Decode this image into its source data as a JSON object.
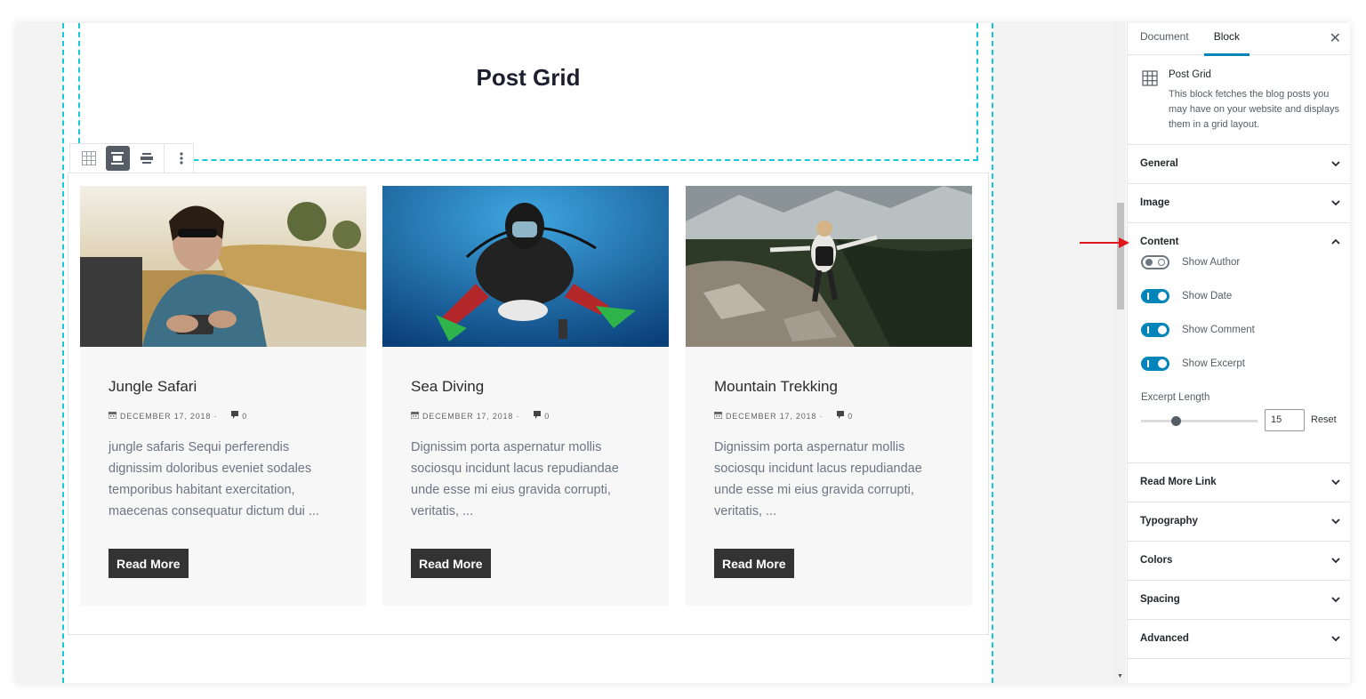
{
  "editor": {
    "heading": "Post Grid"
  },
  "posts": [
    {
      "title": "Jungle Safari",
      "date": "DECEMBER 17, 2018 ·",
      "comments": "0",
      "excerpt": "jungle safaris Sequi perferendis dignissim doloribus eveniet sodales temporibus habitant exercitation, maecenas consequatur dictum dui ...",
      "button": "Read More"
    },
    {
      "title": "Sea Diving",
      "date": "DECEMBER 17, 2018 ·",
      "comments": "0",
      "excerpt": "Dignissim porta aspernatur mollis sociosqu incidunt lacus repudiandae unde esse mi eius gravida corrupti, veritatis, ...",
      "button": "Read More"
    },
    {
      "title": "Mountain Trekking",
      "date": "DECEMBER 17, 2018 ·",
      "comments": "0",
      "excerpt": "Dignissim porta aspernatur mollis sociosqu incidunt lacus repudiandae unde esse mi eius gravida corrupti, veritatis, ...",
      "button": "Read More"
    }
  ],
  "sidebar": {
    "tabs": [
      "Document",
      "Block"
    ],
    "active_tab": "Block",
    "close": "✕",
    "block_title": "Post Grid",
    "block_desc": "This block fetches the blog posts you may have on your website and displays them in a grid layout.",
    "panels": {
      "general": "General",
      "image": "Image",
      "content": "Content",
      "read_more": "Read More Link",
      "typography": "Typography",
      "colors": "Colors",
      "spacing": "Spacing",
      "advanced": "Advanced"
    },
    "toggles": [
      {
        "label": "Show Author",
        "on": false
      },
      {
        "label": "Show Date",
        "on": true
      },
      {
        "label": "Show Comment",
        "on": true
      },
      {
        "label": "Show Excerpt",
        "on": true
      }
    ],
    "excerpt_length_label": "Excerpt Length",
    "excerpt_length_value": "15",
    "excerpt_length_fraction": 0.3,
    "reset_label": "Reset"
  },
  "colors": {
    "accent": "#0085ba",
    "guide": "#16c8d8",
    "button_bg": "#333333",
    "annotation_arrow": "#e0161d"
  }
}
